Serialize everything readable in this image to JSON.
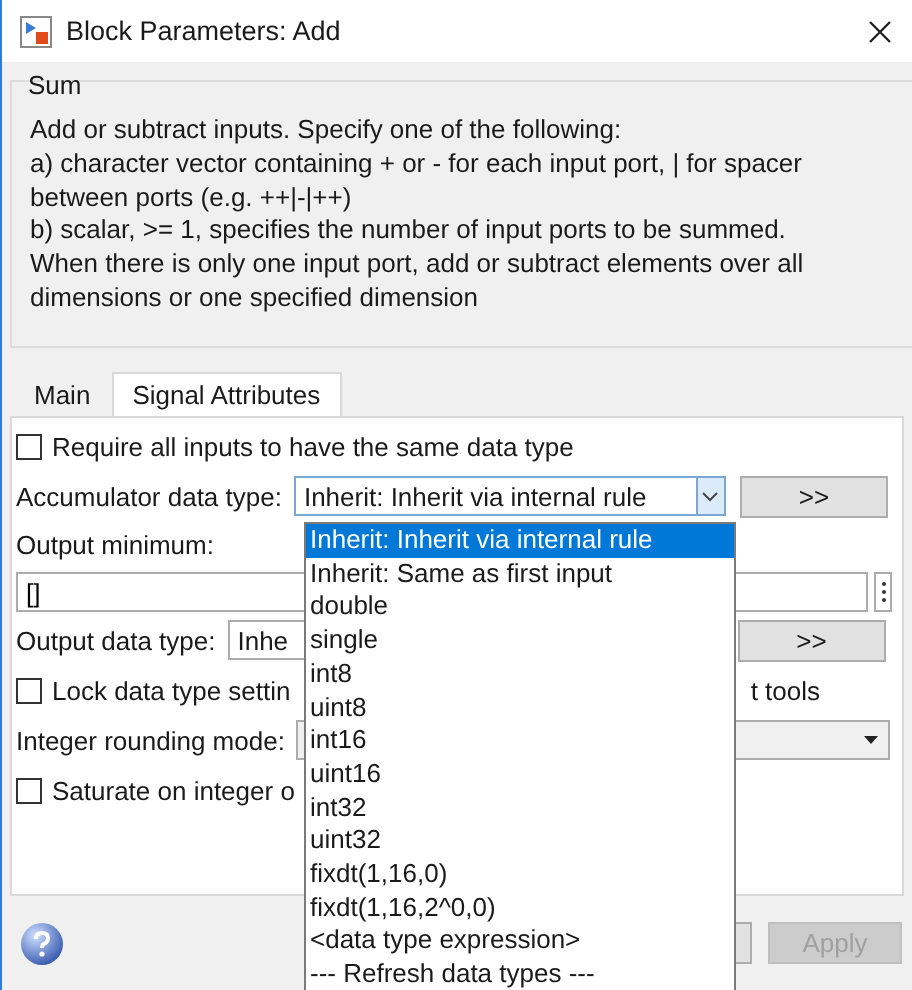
{
  "window": {
    "title": "Block Parameters: Add"
  },
  "group": {
    "title": "Sum",
    "description_lines": [
      "Add or subtract inputs.  Specify one of the following:",
      "a) character vector containing + or - for each input port, | for spacer between ports (e.g. ++|-|++)",
      "b) scalar, >= 1, specifies the number of input ports to be summed.",
      "When there is only one input port, add or subtract elements over all dimensions or one specified dimension"
    ]
  },
  "tabs": [
    {
      "label": "Main",
      "selected": false
    },
    {
      "label": "Signal Attributes",
      "selected": true
    }
  ],
  "require_same_type": {
    "label": "Require all inputs to have the same data type",
    "checked": false
  },
  "accumulator": {
    "label": "Accumulator data type:",
    "value": "Inherit: Inherit via internal rule",
    "assistant_button": ">>"
  },
  "output_minimum": {
    "label": "Output minimum:",
    "value": "[]"
  },
  "output_data_type": {
    "label": "Output data type:",
    "value": "Inhe",
    "assistant_button": ">>"
  },
  "lock_scaling": {
    "label": "Lock data type settin",
    "label_end": "t tools",
    "checked": false
  },
  "rounding": {
    "label": "Integer rounding mode:"
  },
  "saturate": {
    "label": "Saturate on integer o",
    "checked": false
  },
  "dropdown_list": [
    {
      "label": "Inherit: Inherit via internal rule",
      "selected": true
    },
    {
      "label": "Inherit: Same as first input",
      "selected": false
    },
    {
      "label": "double",
      "selected": false
    },
    {
      "label": "single",
      "selected": false
    },
    {
      "label": "int8",
      "selected": false
    },
    {
      "label": "uint8",
      "selected": false
    },
    {
      "label": "int16",
      "selected": false
    },
    {
      "label": "uint16",
      "selected": false
    },
    {
      "label": "int32",
      "selected": false
    },
    {
      "label": "uint32",
      "selected": false
    },
    {
      "label": "fixdt(1,16,0)",
      "selected": false
    },
    {
      "label": "fixdt(1,16,2^0,0)",
      "selected": false
    },
    {
      "label": "<data type expression>",
      "selected": false
    },
    {
      "label": "--- Refresh data types ---",
      "selected": false
    }
  ],
  "buttons": [
    {
      "label": "Apply",
      "disabled": true
    }
  ]
}
